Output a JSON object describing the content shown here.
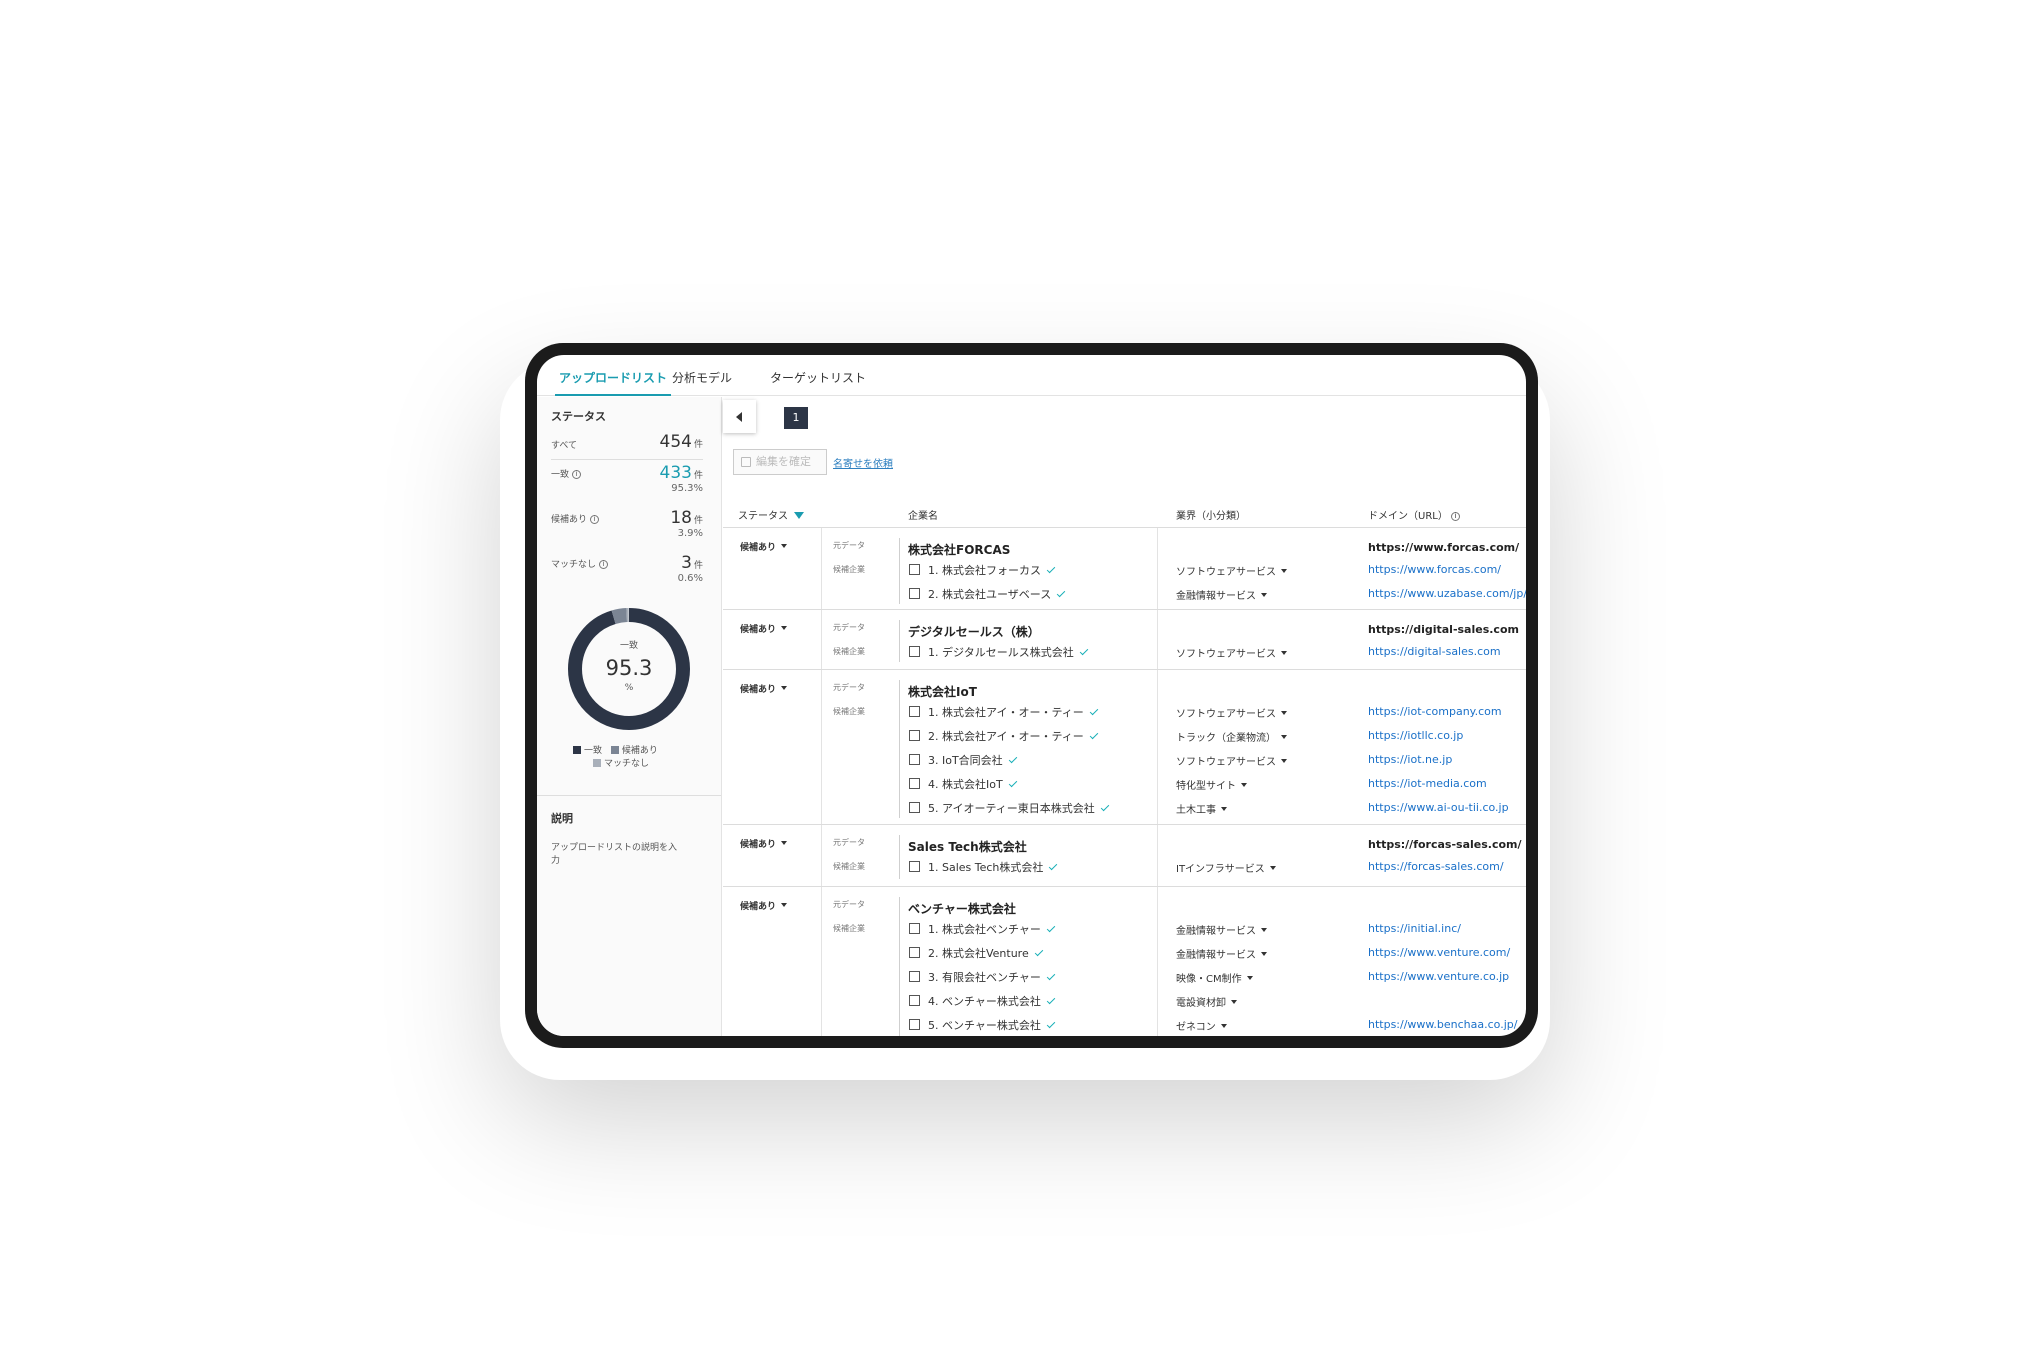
{
  "tabs": [
    {
      "label": "アップロードリスト",
      "active": true
    },
    {
      "label": "分析モデル",
      "active": false
    },
    {
      "label": "ターゲットリスト",
      "active": false
    }
  ],
  "sidebar": {
    "status_title": "ステータス",
    "all": {
      "label": "すべて",
      "count": "454",
      "unit": "件"
    },
    "match": {
      "label": "一致",
      "count": "433",
      "unit": "件",
      "pct": "95.3%"
    },
    "candidate": {
      "label": "候補あり",
      "count": "18",
      "unit": "件",
      "pct": "3.9%"
    },
    "nomatch": {
      "label": "マッチなし",
      "count": "3",
      "unit": "件",
      "pct": "0.6%"
    },
    "donut": {
      "label": "一致",
      "value": "95.3",
      "unit": "%",
      "match_fraction": 0.953,
      "candidate_fraction": 0.039,
      "nomatch_fraction": 0.006
    },
    "legend": [
      "一致",
      "候補あり",
      "マッチなし"
    ],
    "description_title": "説明",
    "description_text_1": "アップロードリストの説明を入",
    "description_text_2": "力"
  },
  "colors": {
    "accent": "#1a9cb0",
    "match": "#2c3546",
    "candidate": "#7b8594",
    "nomatch": "#a9b0ba",
    "link": "#1a70c8"
  },
  "pager": {
    "page": "1"
  },
  "toolbar": {
    "confirm_label": "編集を確定",
    "request_link": "名寄せを依頼"
  },
  "table": {
    "headers": {
      "status": "ステータス",
      "company": "企業名",
      "industry": "業界（小分類）",
      "domain": "ドメイン（URL）"
    },
    "source_label": "元データ",
    "candidate_label": "候補企業",
    "groups": [
      {
        "status": "候補あり",
        "company": "株式会社FORCAS",
        "domain": "https://www.forcas.com/",
        "candidates": [
          {
            "name": "1. 株式会社フォーカス",
            "industry": "ソフトウェアサービス",
            "domain": "https://www.forcas.com/"
          },
          {
            "name": "2. 株式会社ユーザベース",
            "industry": "金融情報サービス",
            "domain": "https://www.uzabase.com/jp/"
          }
        ]
      },
      {
        "status": "候補あり",
        "company": "デジタルセールス（株）",
        "domain": "https://digital-sales.com",
        "candidates": [
          {
            "name": "1. デジタルセールス株式会社",
            "industry": "ソフトウェアサービス",
            "domain": "https://digital-sales.com"
          }
        ]
      },
      {
        "status": "候補あり",
        "company": "株式会社IoT",
        "domain": "",
        "candidates": [
          {
            "name": "1. 株式会社アイ・オー・ティー",
            "industry": "ソフトウェアサービス",
            "domain": "https://iot-company.com"
          },
          {
            "name": "2. 株式会社アイ・オー・ティー",
            "industry": "トラック（企業物流）",
            "domain": "https://iotllc.co.jp"
          },
          {
            "name": "3. IoT合同会社",
            "industry": "ソフトウェアサービス",
            "domain": "https://iot.ne.jp"
          },
          {
            "name": "4. 株式会社IoT",
            "industry": "特化型サイト",
            "domain": "https://iot-media.com"
          },
          {
            "name": "5. アイオーティー東日本株式会社",
            "industry": "土木工事",
            "domain": "https://www.ai-ou-tii.co.jp"
          }
        ]
      },
      {
        "status": "候補あり",
        "company": "Sales Tech株式会社",
        "domain": "https://forcas-sales.com/",
        "candidates": [
          {
            "name": "1. Sales Tech株式会社",
            "industry": "ITインフラサービス",
            "domain": "https://forcas-sales.com/"
          }
        ]
      },
      {
        "status": "候補あり",
        "company": "ベンチャー株式会社",
        "domain": "",
        "candidates": [
          {
            "name": "1. 株式会社ベンチャー",
            "industry": "金融情報サービス",
            "domain": "https://initial.inc/"
          },
          {
            "name": "2. 株式会社Venture",
            "industry": "金融情報サービス",
            "domain": "https://www.venture.com/"
          },
          {
            "name": "3. 有限会社ベンチャー",
            "industry": "映像・CM制作",
            "domain": "https://www.venture.co.jp"
          },
          {
            "name": "4. ベンチャー株式会社",
            "industry": "電設資材卸",
            "domain": ""
          },
          {
            "name": "5. ベンチャー株式会社",
            "industry": "ゼネコン",
            "domain": "https://www.benchaa.co.jp/"
          }
        ]
      }
    ]
  }
}
